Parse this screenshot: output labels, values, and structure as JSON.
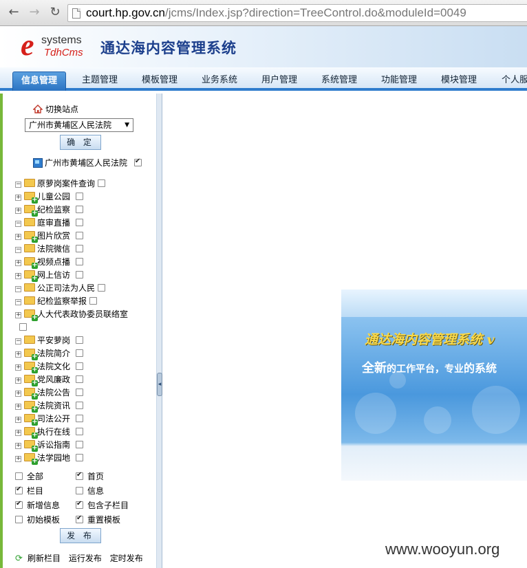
{
  "browser": {
    "url_host": "court.hp.gov.cn",
    "url_path": "/jcms/Index.jsp?direction=TreeControl.do&moduleId=0049"
  },
  "header": {
    "logo_e": "e",
    "logo_systems": "systems",
    "logo_tdh": "TdhCms",
    "title": "通达海内容管理系统"
  },
  "menu": [
    "信息管理",
    "主题管理",
    "模板管理",
    "业务系统",
    "用户管理",
    "系统管理",
    "功能管理",
    "模块管理",
    "个人服"
  ],
  "sidebar": {
    "switch_site": "切换站点",
    "site_select": "广州市黄埔区人民法院",
    "confirm": "确 定",
    "site_root": "广州市黄埔区人民法院",
    "tree": [
      {
        "label": "原萝岗案件查询",
        "open": true
      },
      {
        "label": "儿童公园",
        "open": false
      },
      {
        "label": "纪检监察",
        "open": false
      },
      {
        "label": "庭审直播",
        "open": true
      },
      {
        "label": "图片欣赏",
        "open": false
      },
      {
        "label": "法院微信",
        "open": true
      },
      {
        "label": "视频点播",
        "open": false
      },
      {
        "label": "网上信访",
        "open": false
      },
      {
        "label": "公正司法为人民",
        "open": true
      },
      {
        "label": "纪检监察举报",
        "open": true
      },
      {
        "label": "人大代表政协委员联络室",
        "open": false
      },
      {
        "label": "平安萝岗",
        "open": true
      },
      {
        "label": "法院简介",
        "open": false
      },
      {
        "label": "法院文化",
        "open": false
      },
      {
        "label": "党风廉政",
        "open": false
      },
      {
        "label": "法院公告",
        "open": false
      },
      {
        "label": "法院资讯",
        "open": false
      },
      {
        "label": "司法公开",
        "open": false
      },
      {
        "label": "执行在线",
        "open": false
      },
      {
        "label": "诉讼指南",
        "open": false
      },
      {
        "label": "法学园地",
        "open": false
      }
    ],
    "options": {
      "all": "全部",
      "home": "首页",
      "column": "栏目",
      "info": "信息",
      "new_info": "新增信息",
      "include_sub": "包含子栏目",
      "init_template": "初始模板",
      "reset_template": "重置模板"
    },
    "publish": "发 布",
    "links": [
      "刷新栏目",
      "运行发布",
      "定时发布"
    ]
  },
  "banner": {
    "title": "通达海内容管理系统 v",
    "subtitle_big1": "全新",
    "subtitle_mid": "的工作平台，专业",
    "subtitle_tail": "的系统"
  },
  "watermark": "www.wooyun.org"
}
